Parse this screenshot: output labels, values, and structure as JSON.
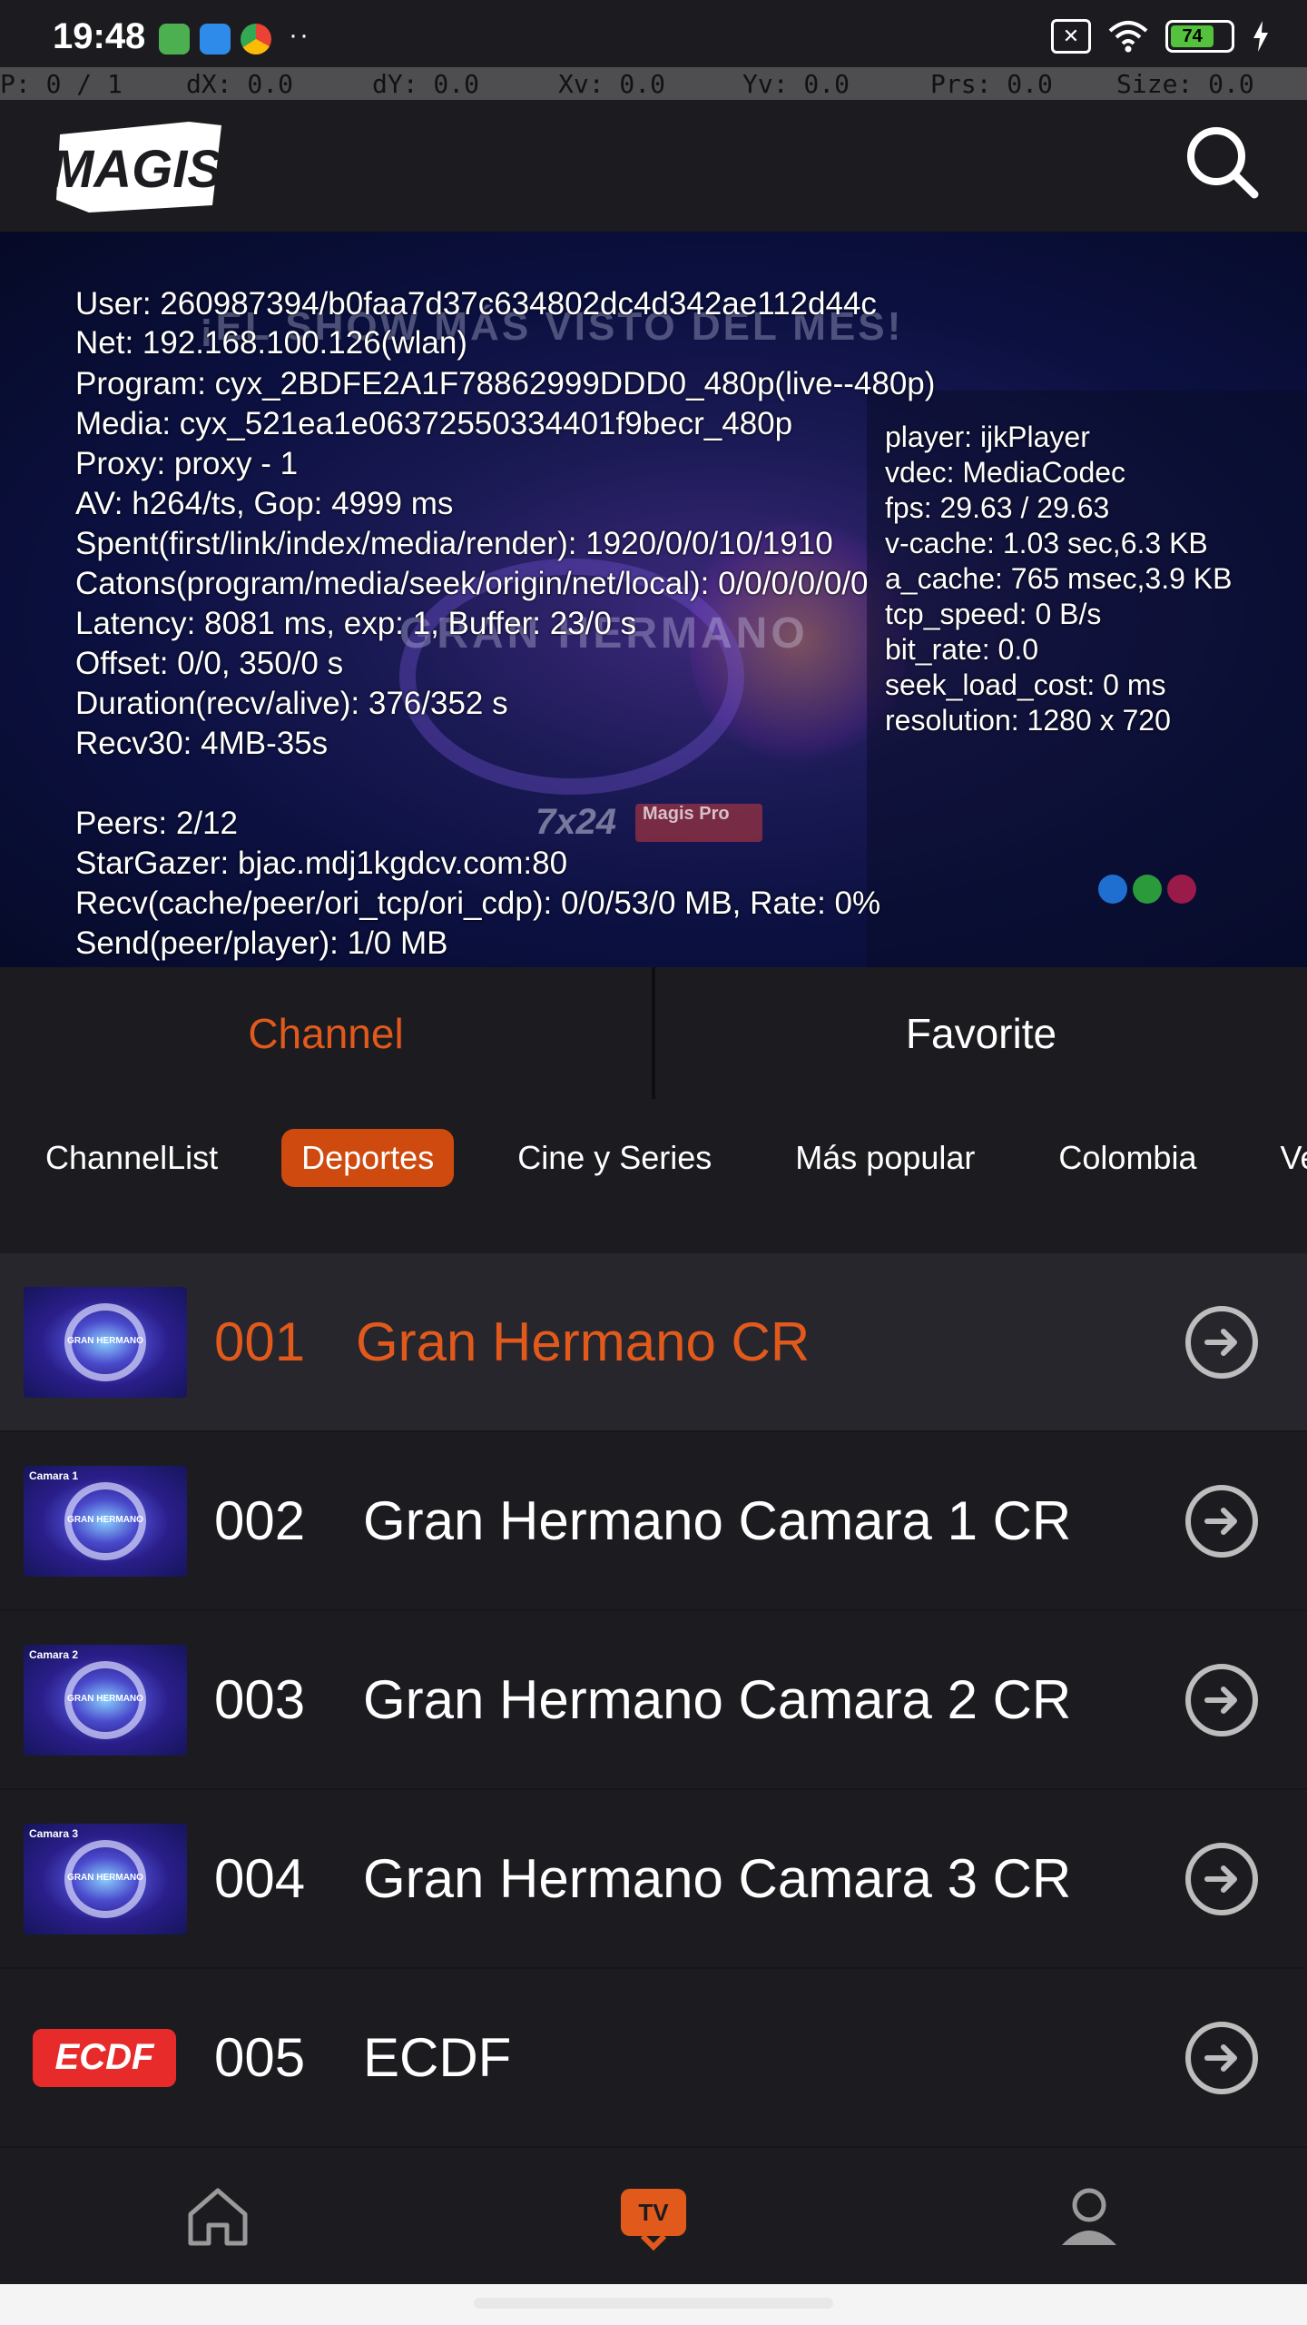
{
  "status_bar": {
    "time": "19:48",
    "more": "··",
    "battery": "74",
    "accent_green": "#54c23d"
  },
  "pointer": {
    "p": "P: 0 / 1",
    "dx": "dX: 0.0",
    "dy": "dY: 0.0",
    "xv": "Xv: 0.0",
    "yv": "Yv: 0.0",
    "prs": "Prs: 0.0",
    "size": "Size: 0.0"
  },
  "header": {
    "logo_text": "MAGIS",
    "search_icon": "search-icon"
  },
  "video": {
    "banner": "¡EL SHOW MÁS VISTO DEL MES!",
    "show_title": "GRAN HERMANO",
    "watermark_7x24": "7x24",
    "watermark_brand": "Magis Pro",
    "debug_left": [
      "User: 260987394/b0faa7d37c634802dc4d342ae112d44c",
      "Net: 192.168.100.126(wlan)",
      "Program: cyx_2BDFE2A1F78862999DDD0_480p(live--480p)",
      "Media: cyx_521ea1e06372550334401f9becr_480p",
      "Proxy: proxy - 1",
      "AV: h264/ts, Gop: 4999 ms",
      "Spent(first/link/index/media/render): 1920/0/0/10/1910",
      "Catons(program/media/seek/origin/net/local): 0/0/0/0/0/0",
      "Latency: 8081 ms, exp: 1, Buffer: 23/0 s",
      "Offset: 0/0, 350/0 s",
      "Duration(recv/alive): 376/352 s",
      "Recv30: 4MB-35s"
    ],
    "debug_peers": [
      "Peers: 2/12",
      "StarGazer: bjac.mdj1kgdcv.com:80",
      "Recv(cache/peer/ori_tcp/ori_cdp): 0/0/53/0 MB, Rate: 0%",
      "Send(peer/player): 1/0 MB"
    ],
    "debug_right": [
      "player: ijkPlayer",
      "vdec: MediaCodec",
      "fps: 29.63 / 29.63",
      "v-cache: 1.03 sec,6.3 KB",
      "a_cache: 765 msec,3.9 KB",
      "tcp_speed: 0 B/s",
      "bit_rate: 0.0",
      "seek_load_cost: 0 ms",
      "resolution: 1280 x 720"
    ]
  },
  "tabs": [
    {
      "label": "Channel",
      "active": true
    },
    {
      "label": "Favorite",
      "active": false
    }
  ],
  "categories": [
    {
      "label": "ChannelList"
    },
    {
      "label": "Deportes",
      "active": true
    },
    {
      "label": "Cine y Series"
    },
    {
      "label": "Más popular"
    },
    {
      "label": "Colombia"
    },
    {
      "label": "Venez"
    }
  ],
  "channels": [
    {
      "number": "001",
      "name": "Gran Hermano CR",
      "thumb_tag": "",
      "selected": true
    },
    {
      "number": "002",
      "name": "Gran Hermano Camara 1 CR",
      "thumb_tag": "Camara 1"
    },
    {
      "number": "003",
      "name": "Gran Hermano Camara 2 CR",
      "thumb_tag": "Camara 2"
    },
    {
      "number": "004",
      "name": "Gran Hermano Camara 3 CR",
      "thumb_tag": "Camara 3"
    },
    {
      "number": "005",
      "name": "ECDF",
      "thumb_tag": "ECDF"
    }
  ],
  "thumb_label": "GRAN HERMANO",
  "bottom_nav": [
    {
      "icon": "home-icon"
    },
    {
      "icon": "tv-icon",
      "label": "TV",
      "active": true
    },
    {
      "icon": "profile-icon"
    }
  ],
  "colors": {
    "accent": "#e2591c",
    "chip_active": "#cf4a0f"
  }
}
